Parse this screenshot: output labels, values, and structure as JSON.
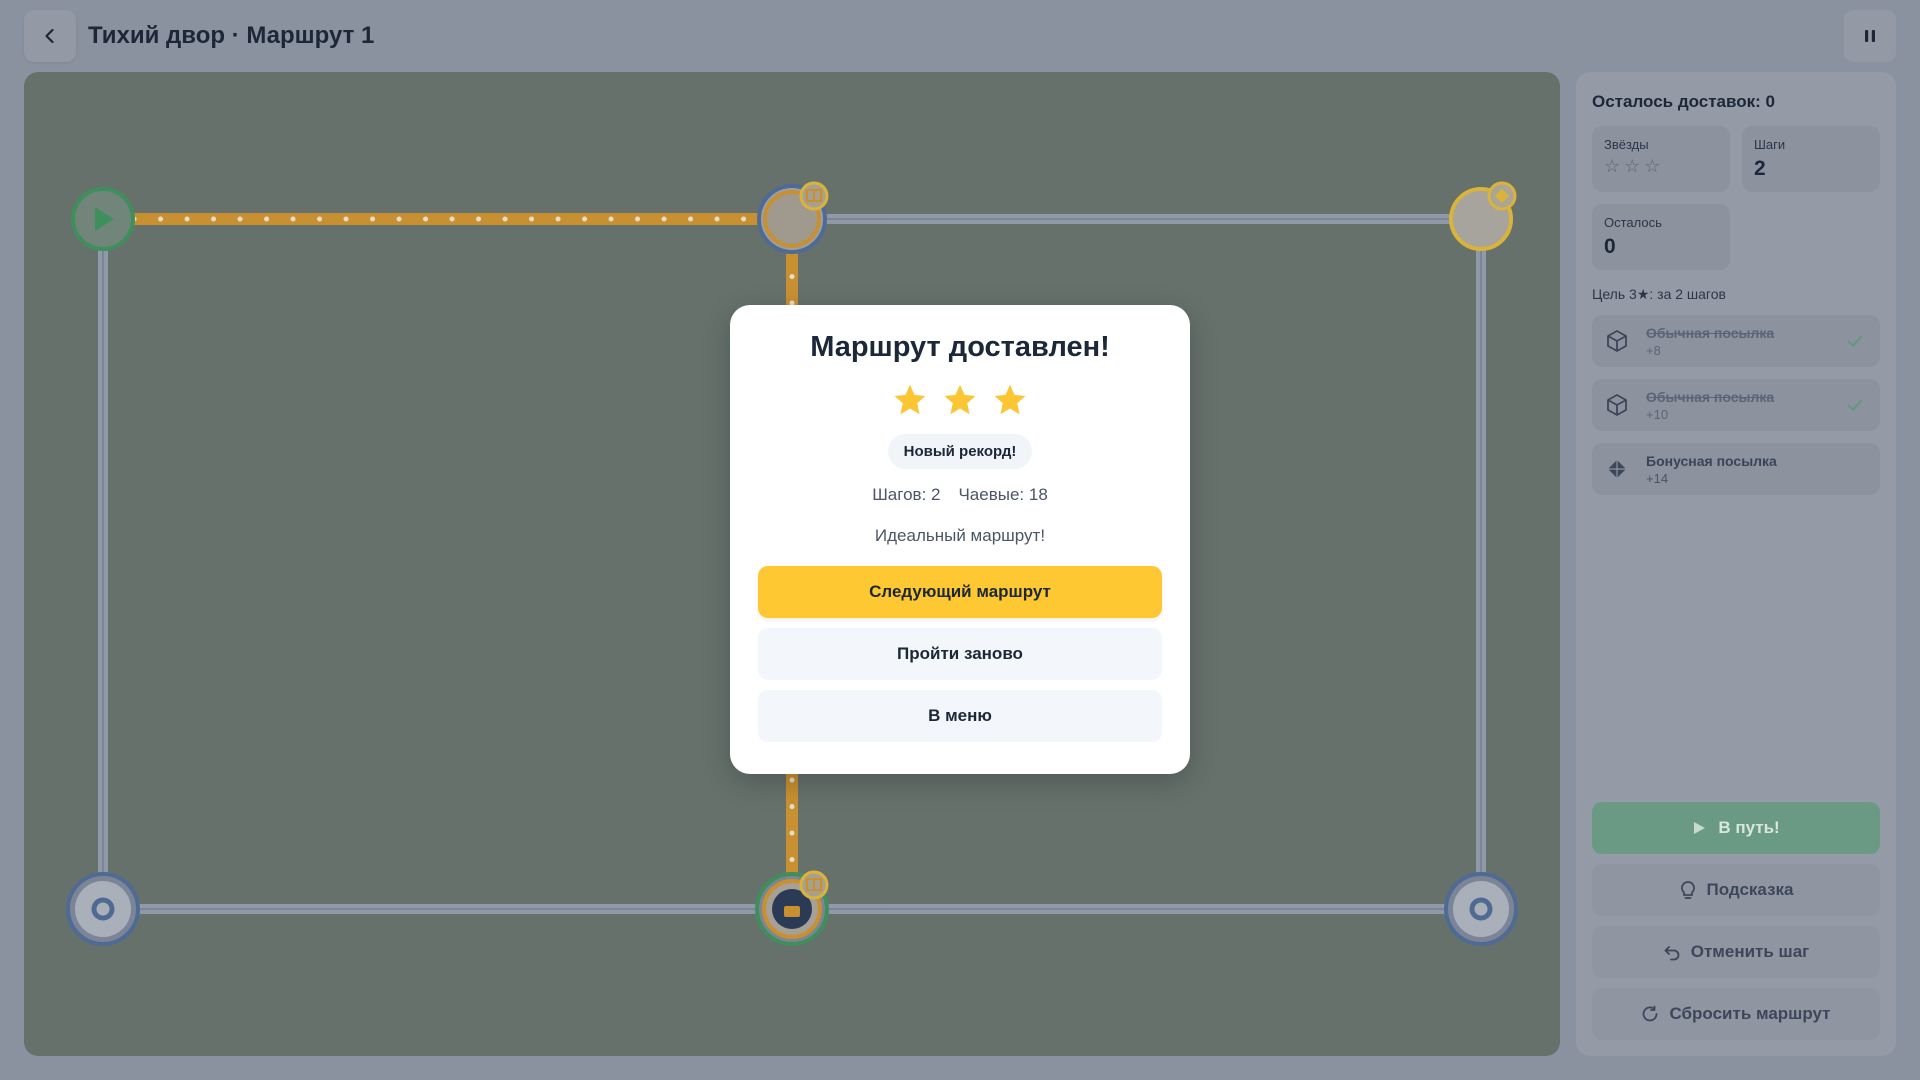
{
  "header": {
    "title": "Тихий двор · Маршрут 1",
    "back_icon": "chevron-left-icon",
    "pause_icon": "pause-icon"
  },
  "board": {
    "nodes": [
      {
        "id": "start",
        "type": "start"
      },
      {
        "id": "top-middle",
        "type": "pickup"
      },
      {
        "id": "top-right",
        "type": "bonus"
      },
      {
        "id": "bottom-left",
        "type": "empty"
      },
      {
        "id": "bottom-middle",
        "type": "courier"
      },
      {
        "id": "bottom-right",
        "type": "empty"
      }
    ],
    "colors": {
      "route": "#c89030",
      "edge": "#8f99a8",
      "start": "#3f8f5c",
      "node": "#4f6b93",
      "bonus": "#d9b33a"
    }
  },
  "panel": {
    "deliveries_left": "Осталось доставок: 0",
    "stats": {
      "stars_label": "Звёзды",
      "stars_value": 0,
      "stars_max": 3,
      "steps_label": "Шаги",
      "steps_value": "2",
      "left_label": "Осталось",
      "left_value": "0"
    },
    "goal": "Цель 3★: за 2 шагов",
    "parcels": [
      {
        "name": "Обычная посылка",
        "bonus": "+8",
        "done": true,
        "icon": "box-icon"
      },
      {
        "name": "Обычная посылка",
        "bonus": "+10",
        "done": true,
        "icon": "box-icon"
      },
      {
        "name": "Бонусная посылка",
        "bonus": "+14",
        "done": false,
        "icon": "diamond-icon"
      }
    ],
    "buttons": {
      "go": "В путь!",
      "hint": "Подсказка",
      "undo": "Отменить шаг",
      "reset": "Сбросить маршрут"
    }
  },
  "modal": {
    "title": "Маршрут доставлен!",
    "stars": 3,
    "badge": "Новый рекорд!",
    "steps": "Шагов: 2",
    "tips": "Чаевые: 18",
    "message": "Идеальный маршрут!",
    "next": "Следующий маршрут",
    "retry": "Пройти заново",
    "menu": "В меню",
    "star_color": "#fcc534"
  }
}
